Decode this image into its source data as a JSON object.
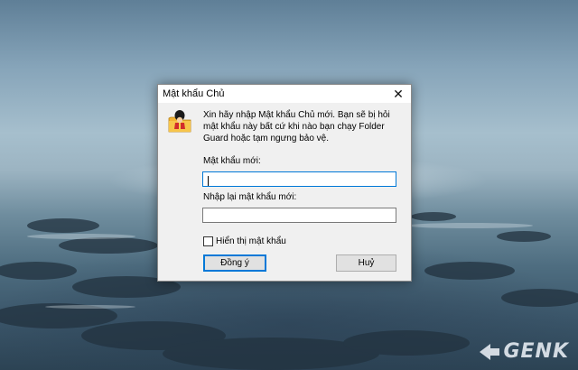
{
  "dialog": {
    "title": "Mật khẩu Chủ",
    "close_label": "✕",
    "message": "Xin hãy nhập Mật khẩu Chủ mới. Bạn sẽ bị hỏi mật khẩu này bất cứ khi nào bạn chạy Folder Guard hoặc tạm ngưng bảo vệ.",
    "new_password_label": "Mật khẩu mới:",
    "new_password_value": "",
    "confirm_password_label": "Nhập lại mật khẩu mới:",
    "confirm_password_value": "",
    "show_password_label": "Hiển thị mật khẩu",
    "show_password_checked": false,
    "ok_label": "Đồng ý",
    "cancel_label": "Huỷ",
    "app_icon": "folder-guard-icon"
  },
  "watermark": {
    "text": "GENK"
  },
  "colors": {
    "focus_blue": "#0078d7",
    "dialog_bg": "#f0f0f0"
  }
}
